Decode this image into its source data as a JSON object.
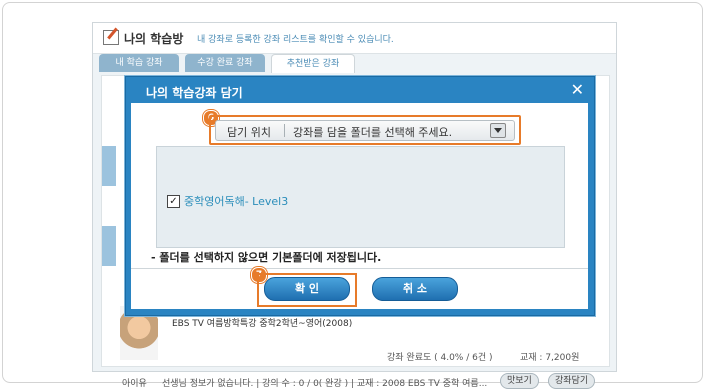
{
  "header": {
    "title": "나의 학습방",
    "description": "내 강좌로 등록한 강좌 리스트를 확인할 수 있습니다."
  },
  "tabs": [
    {
      "label": "내 학습 강좌"
    },
    {
      "label": "수강 완료 강좌"
    },
    {
      "label": "추천받은 강좌"
    }
  ],
  "background": {
    "course_title": "EBS TV 여름방학특강 중학2학년~영어(2008)",
    "progress": "강좌 완료도 ( 4.0% / 6건 )",
    "price": "교재 : 7,200원",
    "teacher_name": "아이유",
    "footer": "선생님 정보가 없습니다. | 강의 수 : 0 / 0( 완강 ) | 교재 : 2008 EBS TV 중학 여름...",
    "btn_view": "맛보기",
    "btn_add": "강좌담기"
  },
  "modal": {
    "title": "나의 학습강좌 담기",
    "close_icon": "close-icon",
    "folder_label": "담기 위치",
    "folder_placeholder": "강좌를 담을 폴더를 선택해 주세요.",
    "badge_folder": "6",
    "item": {
      "label": "중학영어독해- Level3",
      "checked": true
    },
    "notice": "- 폴더를 선택하지 않으면 기본폴더에 저장됩니다.",
    "badge_confirm": "7",
    "confirm_label": "확 인",
    "cancel_label": "취 소"
  },
  "colors": {
    "accent": "#2a84c2",
    "highlight": "#e77b2a",
    "link": "#2a8dba"
  }
}
